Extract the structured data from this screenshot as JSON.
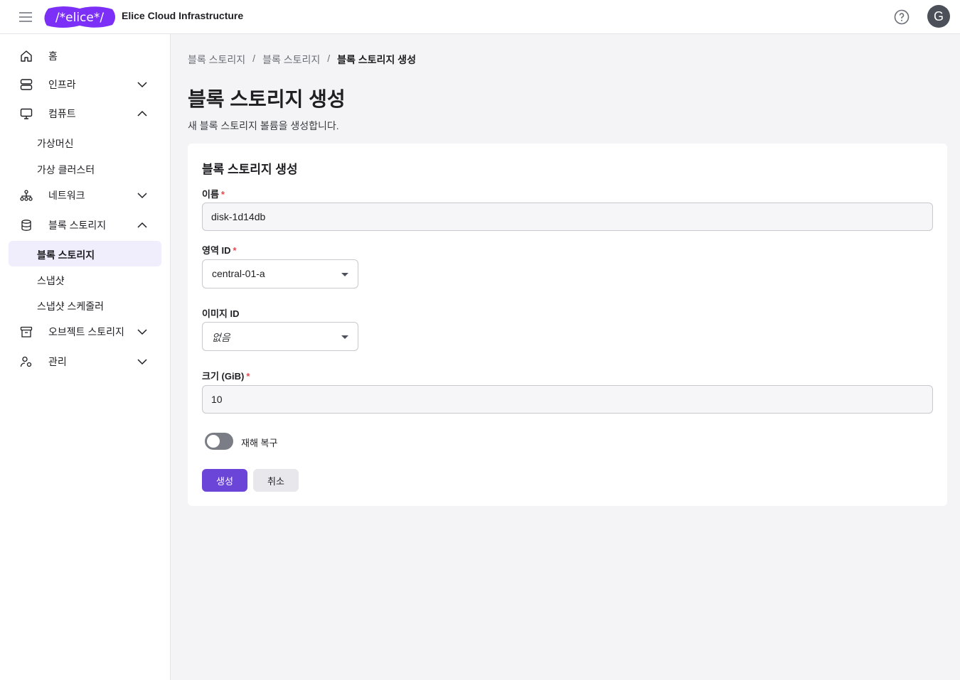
{
  "header": {
    "logo_text": "/*elice*/",
    "app_title": "Elice Cloud Infrastructure",
    "avatar_initial": "G",
    "brand_color": "#7b2ff7"
  },
  "sidebar": {
    "items": [
      {
        "label": "홈",
        "icon": "home-icon"
      },
      {
        "label": "인프라",
        "icon": "server-icon",
        "expanded": false
      },
      {
        "label": "컴퓨트",
        "icon": "monitor-icon",
        "expanded": true
      },
      {
        "label": "가상머신"
      },
      {
        "label": "가상 클러스터"
      },
      {
        "label": "네트워크",
        "icon": "network-icon",
        "expanded": false
      },
      {
        "label": "블록 스토리지",
        "icon": "database-icon",
        "expanded": true
      },
      {
        "label": "블록 스토리지",
        "active": true
      },
      {
        "label": "스냅샷"
      },
      {
        "label": "스냅샷 스케줄러"
      },
      {
        "label": "오브젝트 스토리지",
        "icon": "archive-icon",
        "expanded": false
      },
      {
        "label": "관리",
        "icon": "user-settings-icon",
        "expanded": false
      }
    ]
  },
  "breadcrumb": {
    "items": [
      "블록 스토리지",
      "블록 스토리지"
    ],
    "separator": "/",
    "current": "블록 스토리지 생성"
  },
  "page": {
    "title": "블록 스토리지 생성",
    "description": "새 블록 스토리지 볼륨을 생성합니다."
  },
  "form": {
    "card_title": "블록 스토리지 생성",
    "required_mark": "*",
    "name": {
      "label": "이름",
      "value": "disk-1d14db"
    },
    "zone": {
      "label": "영역 ID",
      "value": "central-01-a"
    },
    "image": {
      "label": "이미지 ID",
      "value": "없음"
    },
    "size": {
      "label": "크기 (GiB)",
      "value": "10"
    },
    "disaster_recovery": {
      "label": "재해 복구",
      "enabled": false
    },
    "submit_label": "생성",
    "cancel_label": "취소",
    "accent_color": "#6b45d8"
  }
}
